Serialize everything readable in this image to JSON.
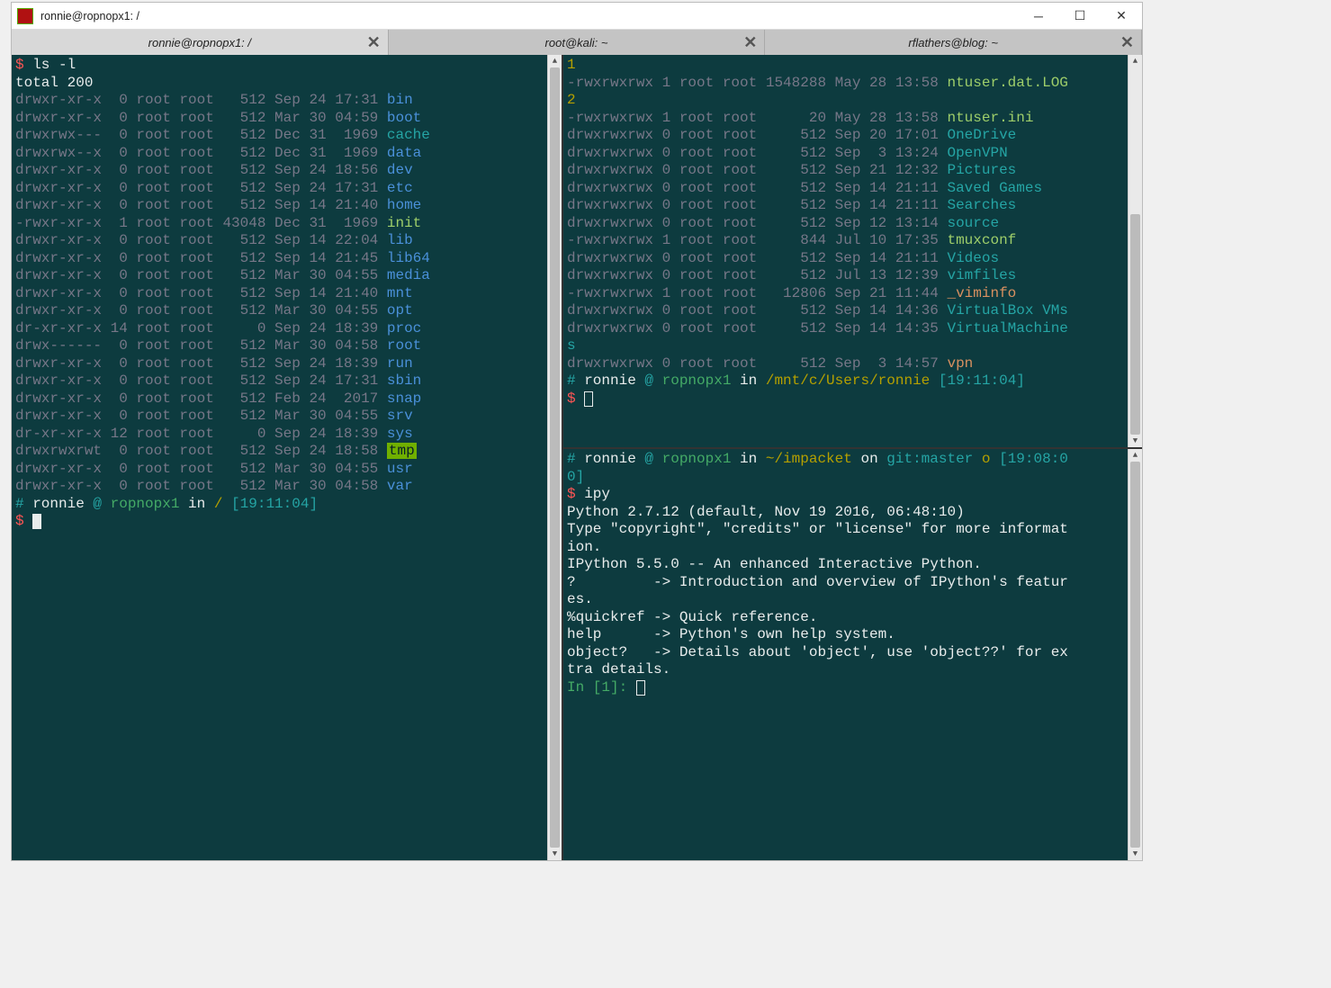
{
  "window": {
    "title": "ronnie@ropnopx1: /"
  },
  "tabs": [
    {
      "label": "ronnie@ropnopx1: /",
      "active": true
    },
    {
      "label": "root@kali: ~",
      "active": false
    },
    {
      "label": "rflathers@blog: ~",
      "active": false
    }
  ],
  "left_pane": {
    "prompt_cmd": "ls -l",
    "total": "total 200",
    "entries": [
      {
        "perm": "drwxr-xr-x",
        "ln": " 0",
        "own": "root root",
        "size": "  512",
        "date": "Sep 24 17:31",
        "name": "bin",
        "cls": "c-blue"
      },
      {
        "perm": "drwxr-xr-x",
        "ln": " 0",
        "own": "root root",
        "size": "  512",
        "date": "Mar 30 04:59",
        "name": "boot",
        "cls": "c-blue"
      },
      {
        "perm": "drwxrwx---",
        "ln": " 0",
        "own": "root root",
        "size": "  512",
        "date": "Dec 31  1969",
        "name": "cache",
        "cls": "c-teal"
      },
      {
        "perm": "drwxrwx--x",
        "ln": " 0",
        "own": "root root",
        "size": "  512",
        "date": "Dec 31  1969",
        "name": "data",
        "cls": "c-blue"
      },
      {
        "perm": "drwxr-xr-x",
        "ln": " 0",
        "own": "root root",
        "size": "  512",
        "date": "Sep 24 18:56",
        "name": "dev",
        "cls": "c-blue"
      },
      {
        "perm": "drwxr-xr-x",
        "ln": " 0",
        "own": "root root",
        "size": "  512",
        "date": "Sep 24 17:31",
        "name": "etc",
        "cls": "c-blue"
      },
      {
        "perm": "drwxr-xr-x",
        "ln": " 0",
        "own": "root root",
        "size": "  512",
        "date": "Sep 14 21:40",
        "name": "home",
        "cls": "c-blue"
      },
      {
        "perm": "-rwxr-xr-x",
        "ln": " 1",
        "own": "root root",
        "size": "43048",
        "date": "Dec 31  1969",
        "name": "init",
        "cls": "c-lgreen"
      },
      {
        "perm": "drwxr-xr-x",
        "ln": " 0",
        "own": "root root",
        "size": "  512",
        "date": "Sep 14 22:04",
        "name": "lib",
        "cls": "c-blue"
      },
      {
        "perm": "drwxr-xr-x",
        "ln": " 0",
        "own": "root root",
        "size": "  512",
        "date": "Sep 14 21:45",
        "name": "lib64",
        "cls": "c-blue"
      },
      {
        "perm": "drwxr-xr-x",
        "ln": " 0",
        "own": "root root",
        "size": "  512",
        "date": "Mar 30 04:55",
        "name": "media",
        "cls": "c-blue"
      },
      {
        "perm": "drwxr-xr-x",
        "ln": " 0",
        "own": "root root",
        "size": "  512",
        "date": "Sep 14 21:40",
        "name": "mnt",
        "cls": "c-blue"
      },
      {
        "perm": "drwxr-xr-x",
        "ln": " 0",
        "own": "root root",
        "size": "  512",
        "date": "Mar 30 04:55",
        "name": "opt",
        "cls": "c-blue"
      },
      {
        "perm": "dr-xr-xr-x",
        "ln": "14",
        "own": "root root",
        "size": "    0",
        "date": "Sep 24 18:39",
        "name": "proc",
        "cls": "c-blue"
      },
      {
        "perm": "drwx------",
        "ln": " 0",
        "own": "root root",
        "size": "  512",
        "date": "Mar 30 04:58",
        "name": "root",
        "cls": "c-blue"
      },
      {
        "perm": "drwxr-xr-x",
        "ln": " 0",
        "own": "root root",
        "size": "  512",
        "date": "Sep 24 18:39",
        "name": "run",
        "cls": "c-blue"
      },
      {
        "perm": "drwxr-xr-x",
        "ln": " 0",
        "own": "root root",
        "size": "  512",
        "date": "Sep 24 17:31",
        "name": "sbin",
        "cls": "c-blue"
      },
      {
        "perm": "drwxr-xr-x",
        "ln": " 0",
        "own": "root root",
        "size": "  512",
        "date": "Feb 24  2017",
        "name": "snap",
        "cls": "c-blue"
      },
      {
        "perm": "drwxr-xr-x",
        "ln": " 0",
        "own": "root root",
        "size": "  512",
        "date": "Mar 30 04:55",
        "name": "srv",
        "cls": "c-blue"
      },
      {
        "perm": "dr-xr-xr-x",
        "ln": "12",
        "own": "root root",
        "size": "    0",
        "date": "Sep 24 18:39",
        "name": "sys",
        "cls": "c-blue"
      },
      {
        "perm": "drwxrwxrwt",
        "ln": " 0",
        "own": "root root",
        "size": "  512",
        "date": "Sep 24 18:58",
        "name": "tmp",
        "cls": "hl-tmp"
      },
      {
        "perm": "drwxr-xr-x",
        "ln": " 0",
        "own": "root root",
        "size": "  512",
        "date": "Mar 30 04:55",
        "name": "usr",
        "cls": "c-blue"
      },
      {
        "perm": "drwxr-xr-x",
        "ln": " 0",
        "own": "root root",
        "size": "  512",
        "date": "Mar 30 04:58",
        "name": "var",
        "cls": "c-blue"
      }
    ],
    "prompt2": {
      "hash": "#",
      "user": "ronnie",
      "at": "@",
      "host": "ropnopx1",
      "in_text": " in ",
      "path": "/",
      "time": "[19:11:04]",
      "dollar": "$"
    }
  },
  "right_top": {
    "pre_line1_num": "1",
    "pre_line1": {
      "perm": "-rwxrwxrwx",
      "ln": "1",
      "own": "root root",
      "size": "1548288",
      "date": "May 28 13:58",
      "name": "ntuser.dat.LOG",
      "cls": "c-lgreen"
    },
    "pre_line2_num": "2",
    "entries": [
      {
        "perm": "-rwxrwxrwx",
        "ln": "1",
        "own": "root root",
        "size": "     20",
        "date": "May 28 13:58",
        "name": "ntuser.ini",
        "cls": "c-lgreen"
      },
      {
        "perm": "drwxrwxrwx",
        "ln": "0",
        "own": "root root",
        "size": "    512",
        "date": "Sep 20 17:01",
        "name": "OneDrive",
        "cls": "c-teal"
      },
      {
        "perm": "drwxrwxrwx",
        "ln": "0",
        "own": "root root",
        "size": "    512",
        "date": "Sep  3 13:24",
        "name": "OpenVPN",
        "cls": "c-teal"
      },
      {
        "perm": "drwxrwxrwx",
        "ln": "0",
        "own": "root root",
        "size": "    512",
        "date": "Sep 21 12:32",
        "name": "Pictures",
        "cls": "c-teal"
      },
      {
        "perm": "drwxrwxrwx",
        "ln": "0",
        "own": "root root",
        "size": "    512",
        "date": "Sep 14 21:11",
        "name": "Saved Games",
        "cls": "c-teal"
      },
      {
        "perm": "drwxrwxrwx",
        "ln": "0",
        "own": "root root",
        "size": "    512",
        "date": "Sep 14 21:11",
        "name": "Searches",
        "cls": "c-teal"
      },
      {
        "perm": "drwxrwxrwx",
        "ln": "0",
        "own": "root root",
        "size": "    512",
        "date": "Sep 12 13:14",
        "name": "source",
        "cls": "c-teal"
      },
      {
        "perm": "-rwxrwxrwx",
        "ln": "1",
        "own": "root root",
        "size": "    844",
        "date": "Jul 10 17:35",
        "name": "tmuxconf",
        "cls": "c-lgreen"
      },
      {
        "perm": "drwxrwxrwx",
        "ln": "0",
        "own": "root root",
        "size": "    512",
        "date": "Sep 14 21:11",
        "name": "Videos",
        "cls": "c-teal"
      },
      {
        "perm": "drwxrwxrwx",
        "ln": "0",
        "own": "root root",
        "size": "    512",
        "date": "Jul 13 12:39",
        "name": "vimfiles",
        "cls": "c-teal"
      },
      {
        "perm": "-rwxrwxrwx",
        "ln": "1",
        "own": "root root",
        "size": "  12806",
        "date": "Sep 21 11:44",
        "name": "_viminfo",
        "cls": "c-orange"
      },
      {
        "perm": "drwxrwxrwx",
        "ln": "0",
        "own": "root root",
        "size": "    512",
        "date": "Sep 14 14:36",
        "name": "VirtualBox VMs",
        "cls": "c-teal"
      },
      {
        "perm": "drwxrwxrwx",
        "ln": "0",
        "own": "root root",
        "size": "    512",
        "date": "Sep 14 14:35",
        "name": "VirtualMachine",
        "cls": "c-teal"
      }
    ],
    "wraps": "s",
    "last": {
      "perm": "drwxrwxrwx",
      "ln": "0",
      "own": "root root",
      "size": "    512",
      "date": "Sep  3 14:57",
      "name": "vpn",
      "cls": "c-orange"
    },
    "prompt": {
      "hash": "#",
      "user": "ronnie",
      "at": "@",
      "host": "ropnopx1",
      "in_text": " in ",
      "path": "/mnt/c/Users/ronnie",
      "time": "[19:11:04]",
      "dollar": "$"
    }
  },
  "right_bottom": {
    "prompt": {
      "hash": "#",
      "user": "ronnie",
      "at": "@",
      "host": "ropnopx1",
      "in_text": " in ",
      "path": "~/impacket",
      "on_text": " on ",
      "git_label": "git:",
      "branch": "master",
      "dirty": " o",
      "time": "[19:08:0",
      "time_wrap": "0]",
      "dollar": "$"
    },
    "cmd": "ipy",
    "lines": [
      "Python 2.7.12 (default, Nov 19 2016, 06:48:10)",
      "Type \"copyright\", \"credits\" or \"license\" for more informat",
      "ion.",
      "",
      "IPython 5.5.0 -- An enhanced Interactive Python.",
      "?         -> Introduction and overview of IPython's featur",
      "es.",
      "%quickref -> Quick reference.",
      "help      -> Python's own help system.",
      "object?   -> Details about 'object', use 'object??' for ex",
      "tra details."
    ],
    "ipy_prompt": "In [1]: "
  }
}
